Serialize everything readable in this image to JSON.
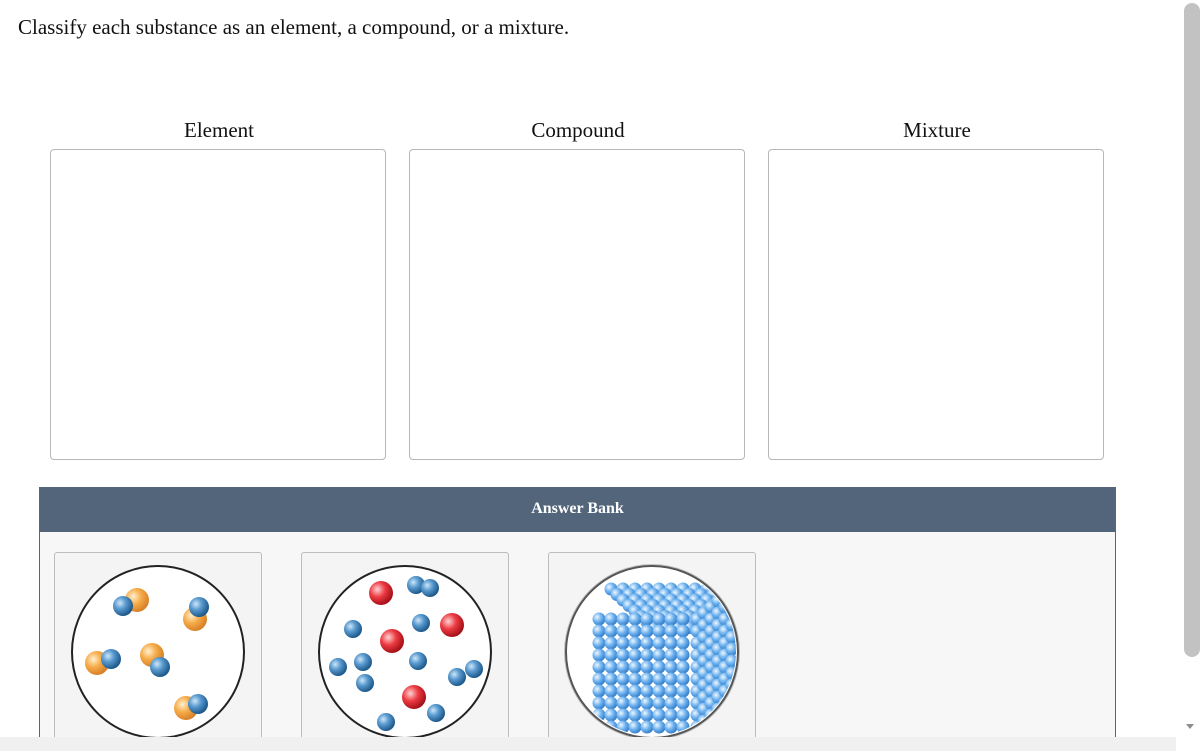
{
  "prompt": "Classify each substance as an element, a compound, or a mixture.",
  "bins": [
    {
      "label": "Element"
    },
    {
      "label": "Compound"
    },
    {
      "label": "Mixture"
    }
  ],
  "answer_bank": {
    "title": "Answer Bank",
    "items": [
      {
        "icon": "diatomic-molecules-image"
      },
      {
        "icon": "mixed-atoms-image"
      },
      {
        "icon": "crystal-lattice-image"
      }
    ]
  },
  "colors": {
    "bank_header": "#52657b",
    "blue_atom": "#3f86c4",
    "orange_atom": "#f5a848",
    "red_atom": "#e8323a"
  }
}
